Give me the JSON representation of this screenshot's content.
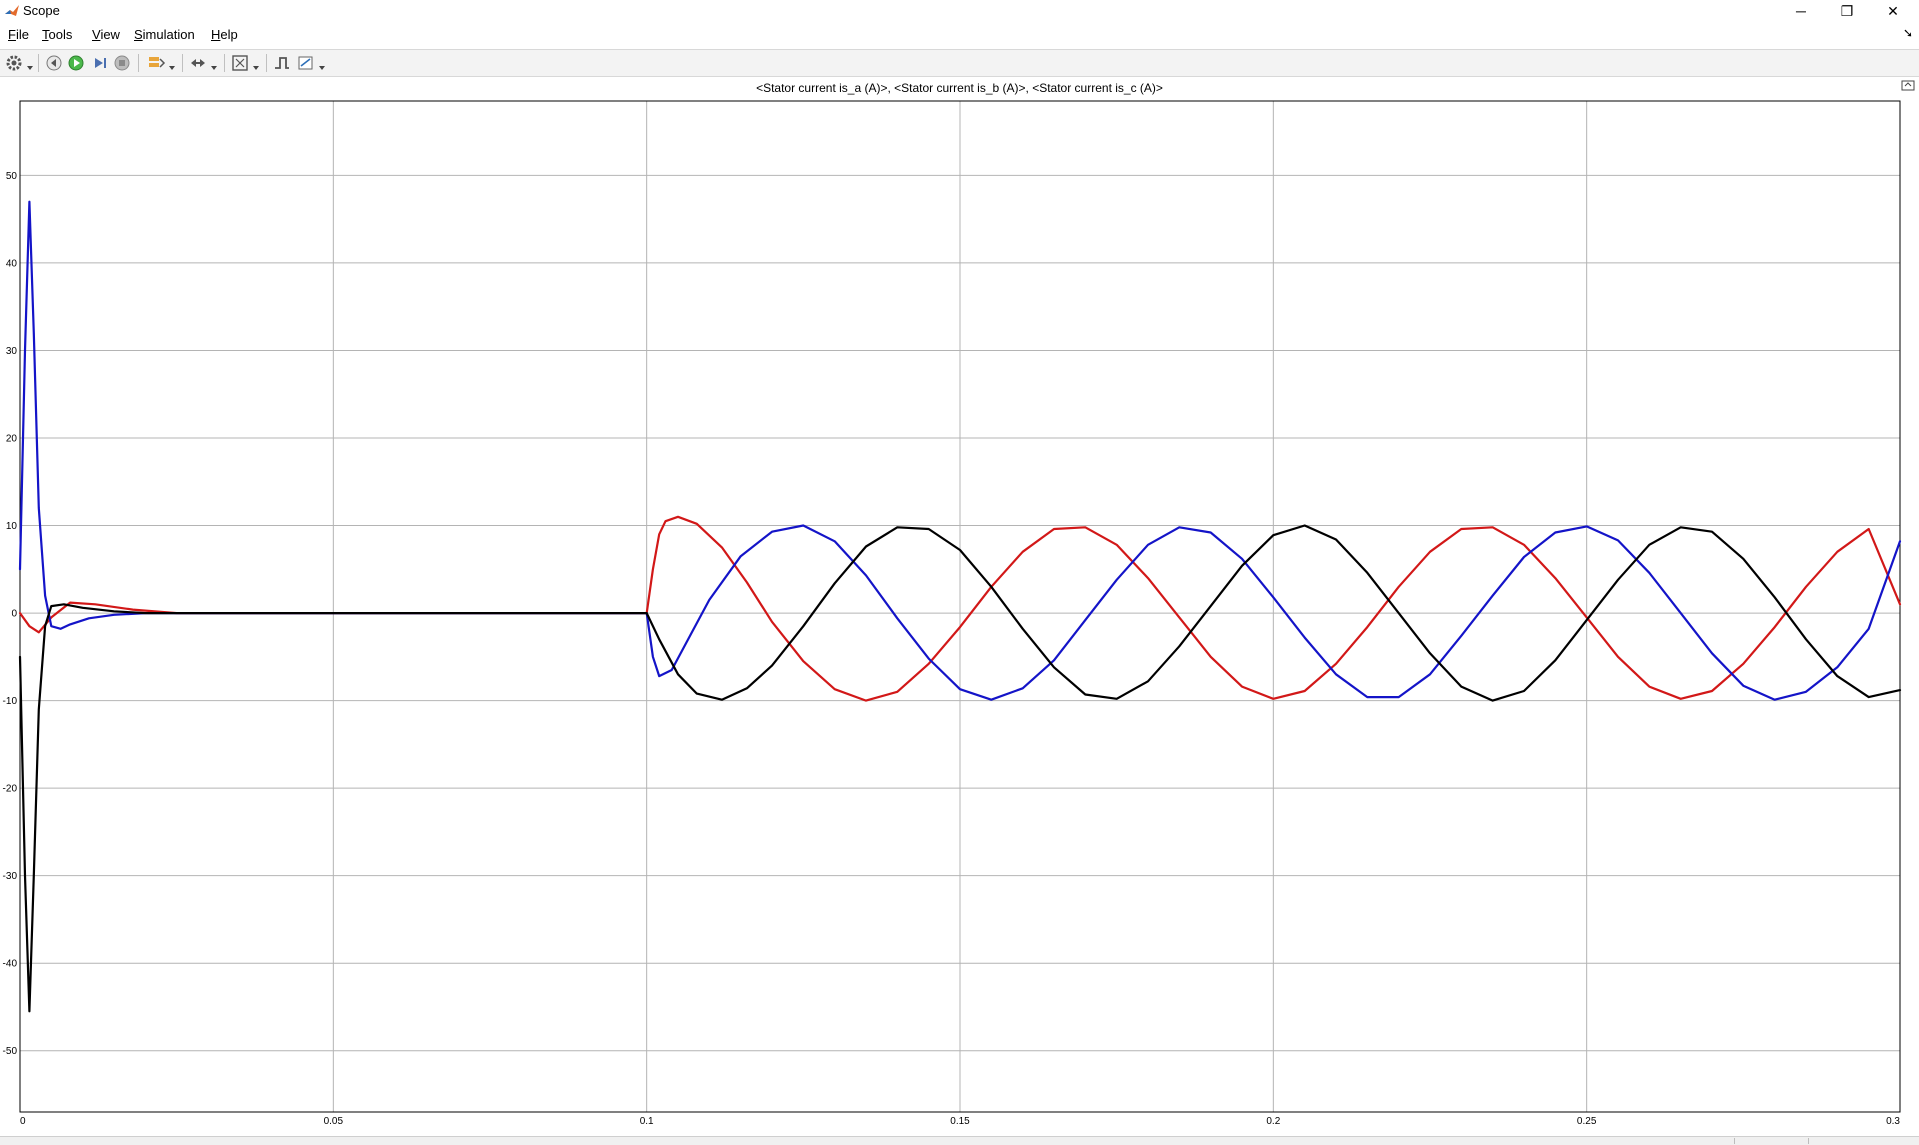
{
  "window": {
    "title": "Scope",
    "controls": {
      "minimize": "─",
      "restore": "❐",
      "close": "✕"
    }
  },
  "menu": {
    "items": [
      {
        "label": "File",
        "mnemonic": "F",
        "rest": "ile"
      },
      {
        "label": "Tools",
        "mnemonic": "T",
        "rest": "ools"
      },
      {
        "label": "View",
        "mnemonic": "V",
        "rest": "iew"
      },
      {
        "label": "Simulation",
        "mnemonic": "S",
        "rest": "imulation"
      },
      {
        "label": "Help",
        "mnemonic": "H",
        "rest": "elp"
      }
    ]
  },
  "toolbar": {
    "icons": [
      "settings-icon",
      "step-back-icon",
      "run-icon",
      "step-forward-icon",
      "stop-icon",
      "highlight-icon",
      "zoom-icon",
      "fit-to-view-icon",
      "triggers-icon",
      "measurements-icon"
    ]
  },
  "colors": {
    "is_a": "#d21818",
    "is_b": "#1414c8",
    "is_c": "#000000",
    "grid": "#b4b4b4",
    "run": "#4bb84b"
  },
  "plot": {
    "title": "<Stator current is_a (A)>, <Stator current is_b (A)>, <Stator current is_c (A)>"
  },
  "chart_data": {
    "type": "line",
    "title": "<Stator current is_a (A)>, <Stator current is_b (A)>, <Stator current is_c (A)>",
    "xlabel": "",
    "ylabel": "",
    "xlim": [
      0,
      0.3
    ],
    "ylim": [
      -57,
      58.5
    ],
    "grid": true,
    "xticks": [
      0,
      0.05,
      0.1,
      0.15,
      0.2,
      0.25,
      0.3
    ],
    "xtick_labels": [
      "0",
      "0.05",
      "0.1",
      "0.15",
      "0.2",
      "0.25",
      "0.3"
    ],
    "yticks": [
      50,
      40,
      30,
      20,
      10,
      0,
      -10,
      -20,
      -30,
      -40,
      -50
    ],
    "ytick_labels": [
      "50",
      "40",
      "30",
      "20",
      "10",
      "0",
      "-10",
      "-20",
      "-30",
      "-40",
      "-50"
    ],
    "series": [
      {
        "id": "is_a",
        "color": "#d21818",
        "x": [
          0,
          0.0015,
          0.003,
          0.005,
          0.008,
          0.012,
          0.018,
          0.025,
          0.1,
          0.101,
          0.102,
          0.103,
          0.105,
          0.108,
          0.112,
          0.116,
          0.12,
          0.125,
          0.13,
          0.135,
          0.14,
          0.145,
          0.15,
          0.155,
          0.16,
          0.165,
          0.17,
          0.175,
          0.18,
          0.185,
          0.19,
          0.195,
          0.2,
          0.205,
          0.21,
          0.215,
          0.22,
          0.225,
          0.23,
          0.235,
          0.24,
          0.245,
          0.25,
          0.255,
          0.26,
          0.265,
          0.27,
          0.275,
          0.28,
          0.285,
          0.29,
          0.295,
          0.3
        ],
        "y": [
          0,
          -1.5,
          -2.2,
          -0.5,
          1.2,
          1.0,
          0.4,
          0,
          0,
          5,
          9,
          10.5,
          11,
          10.2,
          7.5,
          3.5,
          -1,
          -5.5,
          -8.7,
          -10,
          -9,
          -5.8,
          -1.6,
          3,
          7,
          9.6,
          9.8,
          7.8,
          4,
          -0.5,
          -5,
          -8.4,
          -9.8,
          -8.9,
          -5.8,
          -1.6,
          3,
          7,
          9.6,
          9.8,
          7.8,
          4,
          -0.5,
          -5,
          -8.4,
          -9.8,
          -8.9,
          -5.8,
          -1.6,
          3,
          7,
          9.6,
          1
        ]
      },
      {
        "id": "is_b",
        "color": "#1414c8",
        "x": [
          0,
          0.0008,
          0.0015,
          0.0022,
          0.003,
          0.004,
          0.005,
          0.0065,
          0.008,
          0.011,
          0.015,
          0.02,
          0.1,
          0.101,
          0.102,
          0.104,
          0.107,
          0.11,
          0.115,
          0.12,
          0.125,
          0.13,
          0.135,
          0.14,
          0.145,
          0.15,
          0.155,
          0.16,
          0.165,
          0.17,
          0.175,
          0.18,
          0.185,
          0.19,
          0.195,
          0.2,
          0.205,
          0.21,
          0.215,
          0.22,
          0.225,
          0.23,
          0.235,
          0.24,
          0.245,
          0.25,
          0.255,
          0.26,
          0.265,
          0.27,
          0.275,
          0.28,
          0.285,
          0.29,
          0.295,
          0.3
        ],
        "y": [
          5,
          30,
          47,
          32,
          12,
          2,
          -1.5,
          -1.8,
          -1.3,
          -0.6,
          -0.2,
          0,
          0,
          -5,
          -7.2,
          -6.5,
          -2.5,
          1.5,
          6.5,
          9.3,
          10,
          8.2,
          4.3,
          -0.6,
          -5.2,
          -8.7,
          -9.9,
          -8.6,
          -5.4,
          -0.8,
          3.8,
          7.8,
          9.8,
          9.2,
          6.2,
          1.8,
          -2.8,
          -7,
          -9.6,
          -9.6,
          -7,
          -2.6,
          2,
          6.4,
          9.2,
          9.9,
          8.3,
          4.6,
          0,
          -4.6,
          -8.3,
          -9.9,
          -9,
          -6.2,
          -1.8,
          8.2
        ]
      },
      {
        "id": "is_c",
        "color": "#000000",
        "x": [
          0,
          0.0008,
          0.0015,
          0.0022,
          0.003,
          0.004,
          0.005,
          0.007,
          0.01,
          0.015,
          0.02,
          0.1,
          0.102,
          0.105,
          0.108,
          0.112,
          0.116,
          0.12,
          0.125,
          0.13,
          0.135,
          0.14,
          0.145,
          0.15,
          0.155,
          0.16,
          0.165,
          0.17,
          0.175,
          0.18,
          0.185,
          0.19,
          0.195,
          0.2,
          0.205,
          0.21,
          0.215,
          0.22,
          0.225,
          0.23,
          0.235,
          0.24,
          0.245,
          0.25,
          0.255,
          0.26,
          0.265,
          0.27,
          0.275,
          0.28,
          0.285,
          0.29,
          0.295,
          0.3
        ],
        "y": [
          -5,
          -30,
          -45.5,
          -30,
          -11,
          -1.5,
          0.8,
          1.0,
          0.6,
          0.2,
          0,
          0,
          -3,
          -7,
          -9.2,
          -9.9,
          -8.6,
          -6,
          -1.5,
          3.4,
          7.6,
          9.8,
          9.6,
          7.2,
          3,
          -1.8,
          -6.2,
          -9.3,
          -9.8,
          -7.8,
          -3.8,
          0.8,
          5.4,
          8.9,
          10,
          8.4,
          4.6,
          0,
          -4.6,
          -8.4,
          -10,
          -8.9,
          -5.4,
          -0.8,
          3.8,
          7.8,
          9.8,
          9.3,
          6.2,
          1.8,
          -3,
          -7.2,
          -9.6,
          -8.8
        ]
      }
    ]
  }
}
